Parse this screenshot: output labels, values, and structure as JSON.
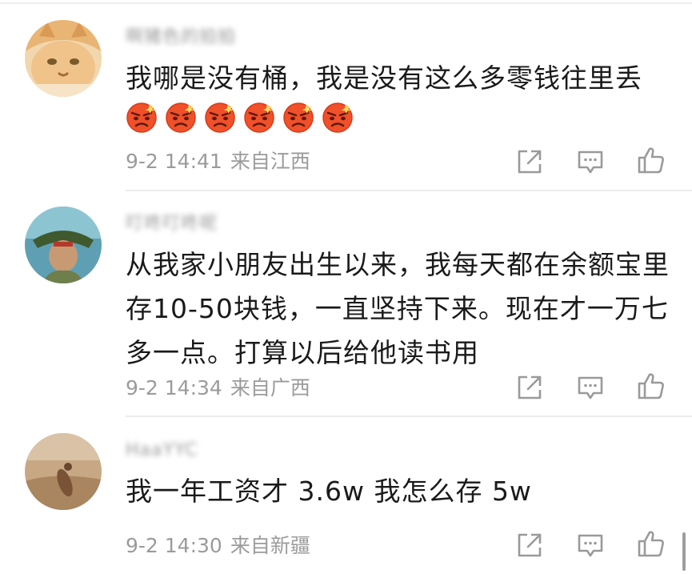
{
  "comments": [
    {
      "username": "啊猪色的拍拍",
      "text_lines": [
        "我哪是没有桶，我是没有这么多零钱往里丢"
      ],
      "emojis": [
        "angry-face-icon",
        "angry-face-icon",
        "angry-face-icon",
        "angry-face-icon",
        "angry-face-icon",
        "angry-face-icon"
      ],
      "time": "9-2 14:41",
      "location": "来自江西"
    },
    {
      "username": "叮咚叮咚呢",
      "text_lines": [
        "从我家小朋友出生以来，我每天都在余额宝里",
        "存10-50块钱，一直坚持下来。现在才一万七",
        "多一点。打算以后给他读书用"
      ],
      "emojis": [],
      "time": "9-2 14:34",
      "location": "来自广西"
    },
    {
      "username": "HaaYYC",
      "text_lines": [
        "我一年工资才 3.6w 我怎么存 5w"
      ],
      "emojis": [],
      "time": "9-2 14:30",
      "location": "来自新疆"
    }
  ],
  "action_icons": [
    "share-icon",
    "comment-icon",
    "like-icon"
  ],
  "colors": {
    "text": "#1a1a1a",
    "meta": "#9b9b9b",
    "divider": "#ececec",
    "emoji": "#f0502a"
  }
}
